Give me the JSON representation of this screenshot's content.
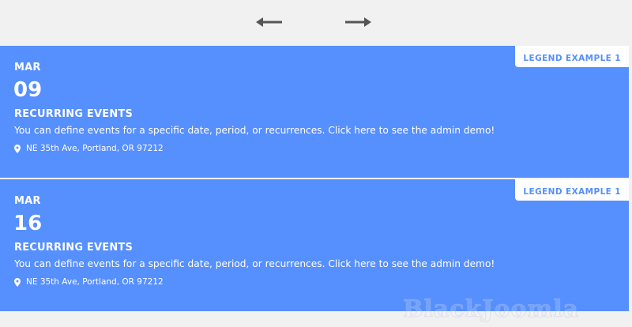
{
  "nav": {
    "prev_icon": "arrow-left-icon",
    "next_icon": "arrow-right-icon",
    "arrow_color": "#555555"
  },
  "accent_color": "#568ffe",
  "events": [
    {
      "legend": "LEGEND EXAMPLE 1",
      "month": "MAR",
      "day": "09",
      "title": "RECURRING EVENTS",
      "description": "You can define events for a specific date, period, or recurrences. Click here to see the admin demo!",
      "location_icon": "map-pin-icon",
      "location": "NE 35th Ave, Portland, OR 97212"
    },
    {
      "legend": "LEGEND EXAMPLE 1",
      "month": "MAR",
      "day": "16",
      "title": "RECURRING EVENTS",
      "description": "You can define events for a specific date, period, or recurrences. Click here to see the admin demo!",
      "location_icon": "map-pin-icon",
      "location": "NE 35th Ave, Portland, OR 97212"
    }
  ],
  "watermark": "BlackJoomla"
}
